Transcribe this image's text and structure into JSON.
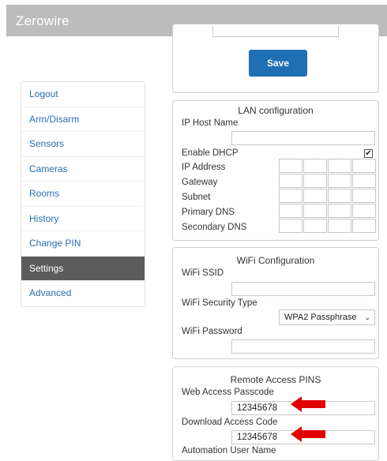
{
  "app": {
    "title": "Zerowire"
  },
  "save_panel": {
    "save_label": "Save"
  },
  "sidebar": {
    "items": [
      {
        "label": "Logout"
      },
      {
        "label": "Arm/Disarm"
      },
      {
        "label": "Sensors"
      },
      {
        "label": "Cameras"
      },
      {
        "label": "Rooms"
      },
      {
        "label": "History"
      },
      {
        "label": "Change PIN"
      },
      {
        "label": "Settings",
        "active": true
      },
      {
        "label": "Advanced"
      }
    ]
  },
  "lan": {
    "title": "LAN configuration",
    "ip_host_name_label": "IP Host Name",
    "ip_host_name_value": "",
    "enable_dhcp_label": "Enable DHCP",
    "enable_dhcp_checked": true,
    "ip_address_label": "IP Address",
    "gateway_label": "Gateway",
    "subnet_label": "Subnet",
    "primary_dns_label": "Primary DNS",
    "secondary_dns_label": "Secondary DNS"
  },
  "wifi": {
    "title": "WiFi Configuration",
    "ssid_label": "WiFi SSID",
    "ssid_value": "",
    "security_type_label": "WiFi Security Type",
    "security_type_value": "WPA2 Passphrase",
    "password_label": "WiFi Password",
    "password_value": ""
  },
  "remote": {
    "title": "Remote Access PINS",
    "web_access_label": "Web Access Passcode",
    "web_access_value": "12345678",
    "download_access_label": "Download Access Code",
    "download_access_value": "12345678",
    "automation_user_label": "Automation User Name"
  },
  "colors": {
    "accent": "#1f6fb5",
    "link": "#2a6fb0",
    "active_nav": "#5c5c5c",
    "header": "#bcbcbc",
    "annotation_arrow": "#e00000"
  }
}
